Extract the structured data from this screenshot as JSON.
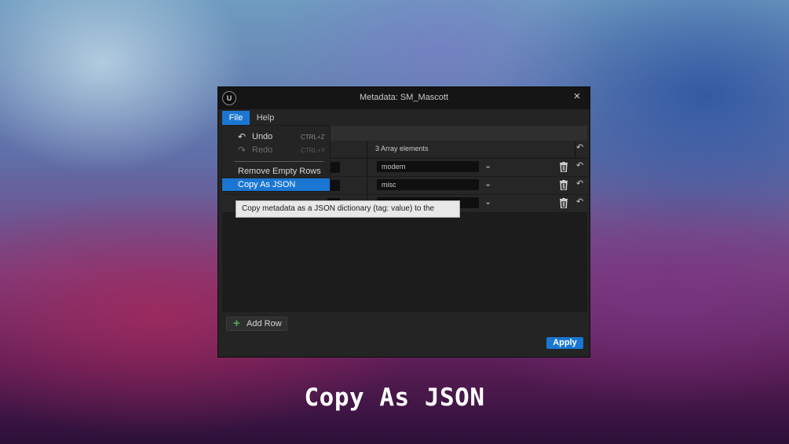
{
  "window": {
    "title": "Metadata: SM_Mascott",
    "logo_text": "U",
    "close_icon": "×"
  },
  "menubar": {
    "items": [
      {
        "label": "File",
        "active": true
      },
      {
        "label": "Help",
        "active": false
      }
    ]
  },
  "file_menu": {
    "items": [
      {
        "label": "Undo",
        "shortcut": "CTRL+Z",
        "icon": "undo-icon",
        "enabled": true
      },
      {
        "label": "Redo",
        "shortcut": "CTRL+Y",
        "icon": "redo-icon",
        "enabled": false
      },
      {
        "label": "Remove Empty Rows",
        "enabled": true
      },
      {
        "label": "Copy As JSON",
        "enabled": true,
        "highlighted": true
      }
    ]
  },
  "tooltip": "Copy metadata as a JSON dictionary (tag: value) to the clipboard.",
  "table": {
    "header": "3 Array elements",
    "rows": [
      {
        "value": "modern"
      },
      {
        "value": "misc"
      },
      {
        "value": ""
      }
    ]
  },
  "buttons": {
    "add_row": "Add Row",
    "apply": "Apply"
  },
  "caption": "Copy As JSON",
  "colors": {
    "accent": "#1a76d2",
    "add_icon": "#4cae4c"
  }
}
